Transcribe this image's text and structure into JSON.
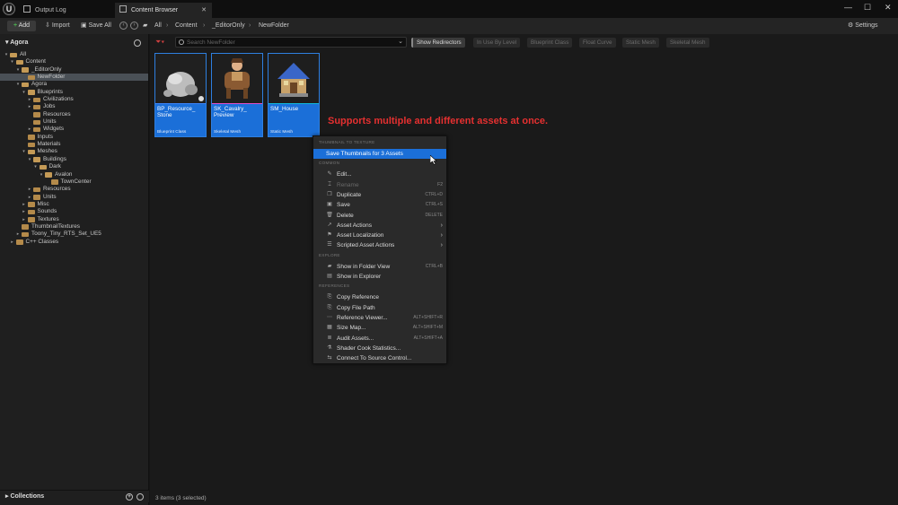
{
  "titlebar": {
    "tabs": [
      {
        "label": "Output Log"
      },
      {
        "label": "Content Browser"
      }
    ],
    "window_controls": [
      "minimize-icon",
      "maximize-icon",
      "close-icon"
    ]
  },
  "toolbar": {
    "add_label": "Add",
    "import_label": "Import",
    "save_all_label": "Save All",
    "breadcrumb": [
      "All",
      "Content",
      "_EditorOnly",
      "NewFolder"
    ],
    "settings_label": "Settings"
  },
  "left_panel": {
    "title": "Agora",
    "tree": [
      {
        "label": "All",
        "depth": 0,
        "expanded": true
      },
      {
        "label": "Content",
        "depth": 1,
        "expanded": true
      },
      {
        "label": "_EditorOnly",
        "depth": 2,
        "expanded": true
      },
      {
        "label": "NewFolder",
        "depth": 3,
        "selected": true
      },
      {
        "label": "Agora",
        "depth": 2,
        "expanded": true
      },
      {
        "label": "Blueprints",
        "depth": 3,
        "expanded": true
      },
      {
        "label": "Civilizations",
        "depth": 4,
        "collapsed": true
      },
      {
        "label": "Jobs",
        "depth": 4,
        "collapsed": true
      },
      {
        "label": "Resources",
        "depth": 4
      },
      {
        "label": "Units",
        "depth": 4
      },
      {
        "label": "Widgets",
        "depth": 4,
        "collapsed": true
      },
      {
        "label": "Inputs",
        "depth": 3
      },
      {
        "label": "Materials",
        "depth": 3
      },
      {
        "label": "Meshes",
        "depth": 3,
        "expanded": true
      },
      {
        "label": "Buildings",
        "depth": 4,
        "expanded": true
      },
      {
        "label": "Dark",
        "depth": 5,
        "expanded": true
      },
      {
        "label": "Avalon",
        "depth": 6,
        "expanded": true
      },
      {
        "label": "TownCenter",
        "depth": 7
      },
      {
        "label": "Resources",
        "depth": 4,
        "collapsed": true
      },
      {
        "label": "Units",
        "depth": 4,
        "collapsed": true
      },
      {
        "label": "Misc",
        "depth": 3,
        "collapsed": true
      },
      {
        "label": "Sounds",
        "depth": 3,
        "collapsed": true
      },
      {
        "label": "Textures",
        "depth": 3,
        "collapsed": true
      },
      {
        "label": "ThumbnailTextures",
        "depth": 2
      },
      {
        "label": "Toony_Tiny_RTS_Set_UE5",
        "depth": 2,
        "collapsed": true
      },
      {
        "label": "C++ Classes",
        "depth": 1,
        "collapsed": true
      }
    ],
    "collections_label": "Collections"
  },
  "main": {
    "search_placeholder": "Search NewFolder",
    "filters": [
      {
        "label": "Show Redirectors",
        "active": true
      },
      {
        "label": "In Use By Level",
        "active": false
      },
      {
        "label": "Blueprint Class",
        "active": false
      },
      {
        "label": "Float Curve",
        "active": false
      },
      {
        "label": "Static Mesh",
        "active": false
      },
      {
        "label": "Skeletal Mesh",
        "active": false
      }
    ],
    "assets": [
      {
        "name": "BP_Resource_ Stone",
        "type": "Blueprint Class",
        "bar_color": "#3b82f6"
      },
      {
        "name": "SK_Cavalry_ Preview",
        "type": "Skeletal Mesh",
        "bar_color": "#e04ec8"
      },
      {
        "name": "SM_House",
        "type": "Static Mesh",
        "bar_color": "#10b7d8"
      }
    ],
    "callout": "Supports multiple and different assets at once.",
    "status": "3 items (3 selected)"
  },
  "context_menu": {
    "sections": [
      {
        "title": "THUMBNAIL TO TEXTURE",
        "items": [
          {
            "label": "Save Thumbnails for 3 Assets",
            "highlighted": true
          }
        ]
      },
      {
        "title": "COMMON",
        "items": [
          {
            "label": "Edit...",
            "icon": "pencil-icon"
          },
          {
            "label": "Rename",
            "shortcut": "F2",
            "disabled": true,
            "icon": "rename-icon"
          },
          {
            "label": "Duplicate",
            "shortcut": "CTRL+D",
            "icon": "duplicate-icon"
          },
          {
            "label": "Save",
            "shortcut": "CTRL+S",
            "icon": "save-icon"
          },
          {
            "label": "Delete",
            "shortcut": "DELETE",
            "icon": "trash-icon"
          },
          {
            "label": "Asset Actions",
            "submenu": true,
            "icon": "wrench-icon"
          },
          {
            "label": "Asset Localization",
            "submenu": true,
            "icon": "flag-icon"
          },
          {
            "label": "Scripted Asset Actions",
            "submenu": true,
            "icon": "script-icon"
          }
        ]
      },
      {
        "title": "EXPLORE",
        "items": [
          {
            "label": "Show in Folder View",
            "shortcut": "CTRL+B",
            "icon": "folder-icon"
          },
          {
            "label": "Show in Explorer",
            "icon": "explorer-icon"
          }
        ]
      },
      {
        "title": "REFERENCES",
        "items": [
          {
            "label": "Copy Reference",
            "icon": "copy-icon"
          },
          {
            "label": "Copy File Path",
            "icon": "copy-icon"
          },
          {
            "label": "Reference Viewer...",
            "shortcut": "ALT+SHIFT+R",
            "icon": "graph-icon"
          },
          {
            "label": "Size Map...",
            "shortcut": "ALT+SHIFT+M",
            "icon": "sizemap-icon"
          },
          {
            "label": "Audit Assets...",
            "shortcut": "ALT+SHIFT+A",
            "icon": "audit-icon"
          },
          {
            "label": "Shader Cook Statistics...",
            "icon": "stats-icon"
          },
          {
            "label": "Connect To Source Control...",
            "icon": "source-control-icon"
          }
        ]
      }
    ]
  }
}
